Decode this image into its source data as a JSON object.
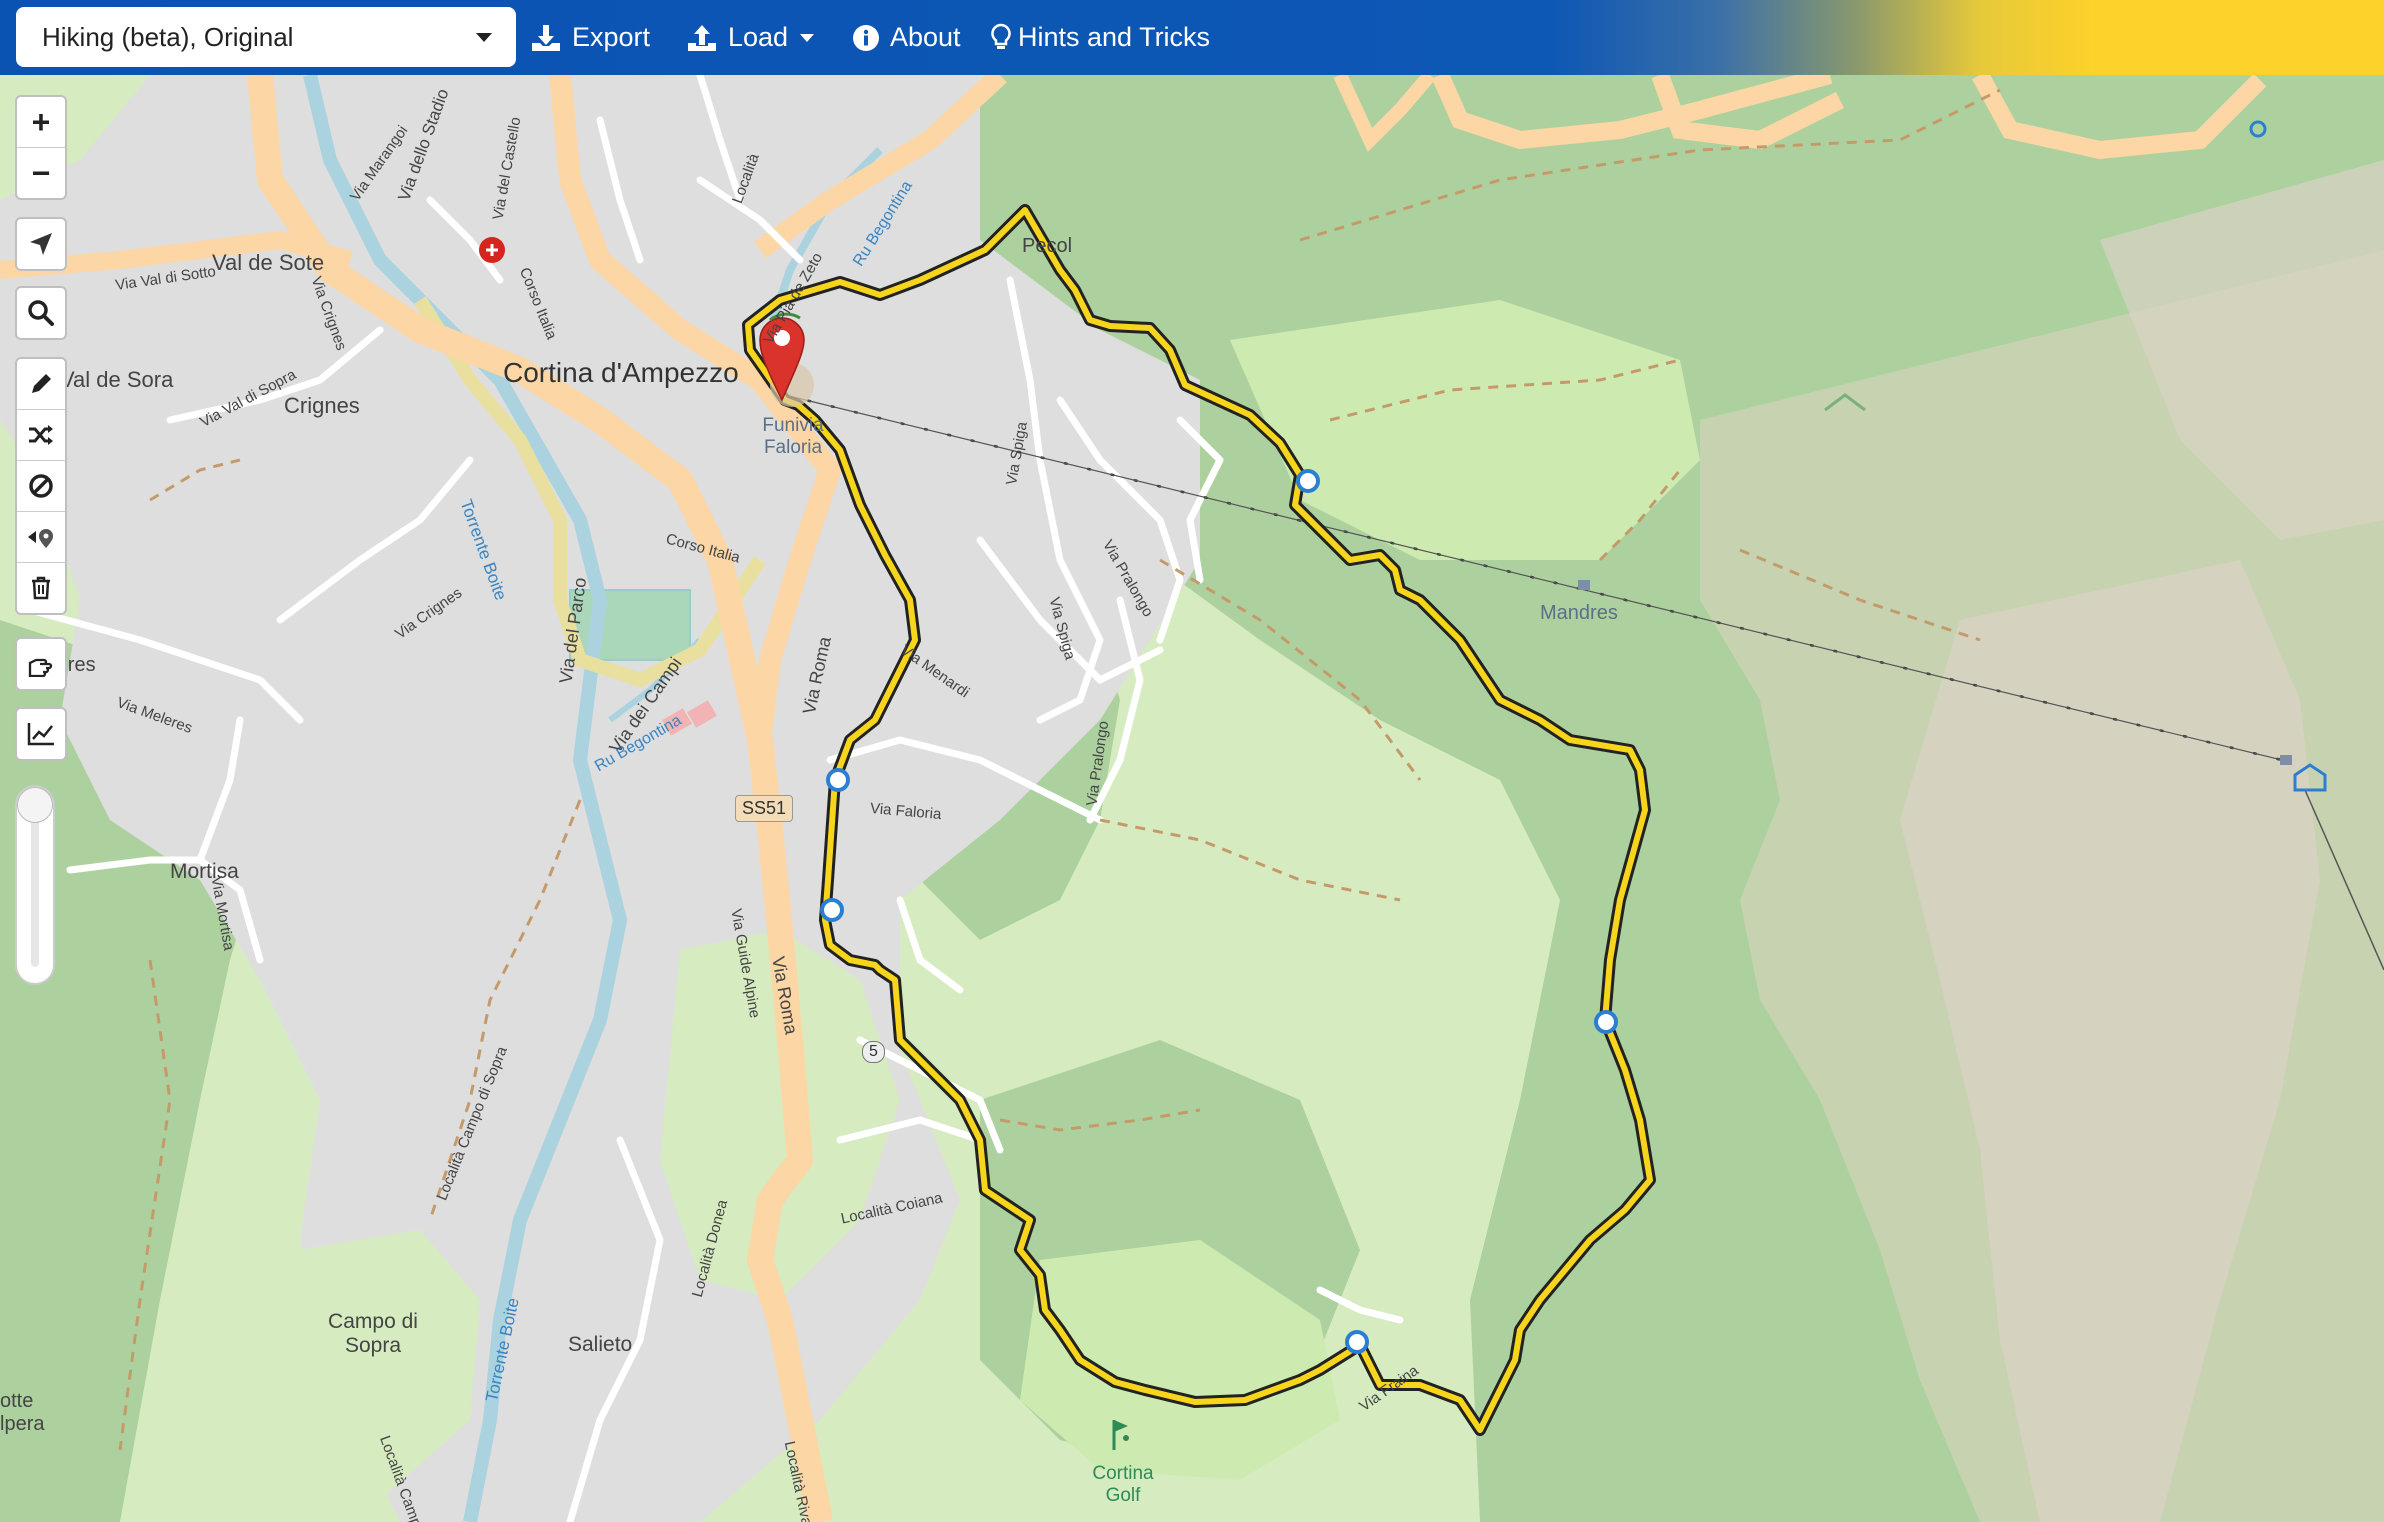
{
  "toolbar": {
    "profile_select_value": "Hiking (beta), Original",
    "export_label": "Export",
    "load_label": "Load",
    "about_label": "About",
    "hints_label": "Hints and Tricks"
  },
  "map": {
    "place_labels": {
      "town": "Cortina d'Ampezzo",
      "val_de_sote": "Val de Sote",
      "val_de_sora": "Val de Sora",
      "crignes": "Crignes",
      "mortisa": "Mortisa",
      "campo_di_sopra": "Campo di Sopra",
      "salieto": "Salieto",
      "mandres": "Mandres",
      "funivia_faloria": "Funivia Faloria",
      "pecol": "Pecol",
      "cortina_golf": "Cortina Golf",
      "meres": "Mères",
      "cotte_alpera": "otte lpera"
    },
    "street_labels": {
      "via_marangoi": "Via Marangoi",
      "via_dello_stadio": "Via dello Stadio",
      "via_del_castello": "Via del Castello",
      "via_val_di_sotto": "Via Val di Sotto",
      "via_crignes": "Via Crignes",
      "via_val_di_sopra": "Via Val di Sopra",
      "corso_italia_1": "Corso Italia",
      "corso_italia_2": "Corso Italia",
      "via_pia_de_zeto": "Via Pia de Zeto",
      "ru_begontina_1": "Ru Begontina",
      "ru_begontina_2": "Ru Begontina",
      "via_del_parco": "Via del Parco",
      "via_dei_campi": "Via dei Campi",
      "via_roma_1": "Via Roma",
      "via_roma_2": "Via Roma",
      "via_meleres": "Via Meleres",
      "via_crignes_2": "Via Crignes",
      "via_spiga_1": "Via Spiga",
      "via_spiga_2": "Via Spiga",
      "via_pralongo_1": "Via Pralongo",
      "via_pralongo_2": "Via Pralongo",
      "via_menardi": "Via Menardi",
      "via_faloria": "Via Faloria",
      "via_guide_alpine": "Via Guide Alpine",
      "torrente_boite_1": "Torrente Boite",
      "torrente_boite_2": "Torrente Boite",
      "via_mortisa": "Via Mortisa",
      "localita_campo_di_sopra_1": "Località Campo di Sopra",
      "localita_campo_di_sopra_2": "Località Campo di Sopra",
      "localita_donea": "Località Donea",
      "localita_coiana": "Località Coiana",
      "localita_riva": "Località Riva",
      "via_fraina": "Via Fraina",
      "localita": "Località",
      "ss51": "SS51",
      "route_5": "5"
    },
    "colors": {
      "route": "#f7d51d",
      "route_outline": "#1a1a1a",
      "forest": "#aed1a0",
      "meadow": "#cdebb0",
      "urban": "#d9d9d9",
      "main_road": "#fcd6a4",
      "marker": "#d9332b",
      "waypoint": "#2a7fd4"
    }
  },
  "controls": {
    "zoom_in": "+",
    "zoom_out": "−"
  }
}
